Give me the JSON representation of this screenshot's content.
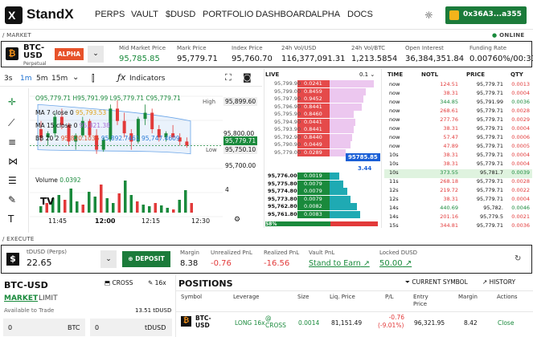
{
  "nav": {
    "brand": "StandX",
    "links": [
      "PERPS",
      "VAULT",
      "$DUSD",
      "PORTFOLIO",
      "DASHBOARD",
      "ALPHA",
      "DOCS"
    ],
    "wallet": "0x36A3...a355"
  },
  "sections": {
    "market": "/ MARKET",
    "online": "ONLINE",
    "execute": "/ EXECUTE"
  },
  "ticker": {
    "symbol": "BTC-USD",
    "subtitle": "Perpetual",
    "badge": "ALPHA",
    "stats": [
      {
        "label": "Mid Market Price",
        "value": "95,785.85",
        "color": "#1a8a3c"
      },
      {
        "label": "Mark Price",
        "value": "95,779.71"
      },
      {
        "label": "Index Price",
        "value": "95,760.70"
      },
      {
        "label": "24h Vol/USD",
        "value": "116,377,091.31"
      },
      {
        "label": "24h Vol/BTC",
        "value": "1,213.5854"
      },
      {
        "label": "Open Interest",
        "value": "36,384,351.84"
      },
      {
        "label": "Funding Rate",
        "value": "0.00760%/00:33"
      }
    ]
  },
  "chart": {
    "intervals": [
      "3s",
      "1m",
      "5m",
      "15m"
    ],
    "active_interval": "1m",
    "indicators_label": "Indicators",
    "ohlc": {
      "o": "O95,779.71",
      "h": "H95,791.99",
      "l": "L95,779.71",
      "c": "C95,779.71"
    },
    "ma7": {
      "label": "MA 7 close 0",
      "value": "95,793.53"
    },
    "ma15": {
      "label": "MA 15 close 0",
      "value": "95,821.38"
    },
    "bb": {
      "label": "BB 20 2",
      "v1": "95,820.1035",
      "v2": "95,892.7461",
      "v3": "95,747.4609"
    },
    "volume": {
      "label": "Volume",
      "value": "0.0392"
    },
    "high_label": "High",
    "high_value": "95,899.60",
    "low_label": "Low",
    "low_value": "95,750.10",
    "current_price": "95,779.71",
    "price_ticks": [
      "95,800.00",
      "95,700.00"
    ],
    "vol_tick": "4",
    "time_ticks": [
      "11:45",
      "12:00",
      "12:15",
      "12:30"
    ],
    "candles": [
      [
        95820,
        95840,
        95790,
        95800
      ],
      [
        95800,
        95815,
        95780,
        95810
      ],
      [
        95810,
        95860,
        95800,
        95850
      ],
      [
        95850,
        95870,
        95820,
        95830
      ],
      [
        95830,
        95835,
        95780,
        95790
      ],
      [
        95790,
        95810,
        95770,
        95805
      ],
      [
        95805,
        95850,
        95800,
        95840
      ],
      [
        95840,
        95845,
        95800,
        95805
      ],
      [
        95805,
        95820,
        95760,
        95770
      ],
      [
        95770,
        95800,
        95765,
        95795
      ],
      [
        95795,
        95880,
        95790,
        95870
      ],
      [
        95870,
        95890,
        95830,
        95840
      ],
      [
        95840,
        95860,
        95800,
        95810
      ],
      [
        95810,
        95820,
        95770,
        95790
      ],
      [
        95790,
        95850,
        95785,
        95845
      ],
      [
        95845,
        95880,
        95830,
        95860
      ],
      [
        95860,
        95870,
        95810,
        95820
      ],
      [
        95820,
        95830,
        95790,
        95800
      ],
      [
        95800,
        95815,
        95790,
        95810
      ],
      [
        95810,
        95830,
        95795,
        95800
      ],
      [
        95800,
        95810,
        95780,
        95790
      ],
      [
        95790,
        95800,
        95775,
        95780
      ]
    ]
  },
  "orderbook": {
    "title": "LIVE",
    "tick": "0.1",
    "asks": [
      [
        "95,799.90",
        "0.0241"
      ],
      [
        "95,799.00",
        "0.8459"
      ],
      [
        "95,797.90",
        "0.9452"
      ],
      [
        "95,796.90",
        "0.8441"
      ],
      [
        "95,795.90",
        "0.8460"
      ],
      [
        "95,794.90",
        "0.0441"
      ],
      [
        "95,793.90",
        "0.8441"
      ],
      [
        "95,792.90",
        "0.8440"
      ],
      [
        "95,790.90",
        "0.0449"
      ],
      [
        "95,779.00",
        "0.0289"
      ]
    ],
    "bids": [
      [
        "95,776.00",
        "0.0019"
      ],
      [
        "95,775.80",
        "0.0079"
      ],
      [
        "95,774.80",
        "0.0079"
      ],
      [
        "95,773.80",
        "0.0079"
      ],
      [
        "95,762.80",
        "0.0082"
      ],
      [
        "95,761.80",
        "0.0083"
      ]
    ],
    "mid_price": "95785.85",
    "spread": "3.44",
    "bid_pct": "58%",
    "ask_pct": "42%"
  },
  "trades": {
    "headers": [
      "TIME",
      "NOTL",
      "PRICE",
      "QTY"
    ],
    "rows": [
      [
        "now",
        "124.51",
        "95,779.71",
        "0.0013",
        "red"
      ],
      [
        "now",
        "38.31",
        "95,779.71",
        "0.0004",
        "red"
      ],
      [
        "now",
        "344.85",
        "95,791.99",
        "0.0036",
        "green"
      ],
      [
        "now",
        "268.61",
        "95,779.71",
        "0.0028",
        "red"
      ],
      [
        "now",
        "277.76",
        "95,779.71",
        "0.0029",
        "red"
      ],
      [
        "now",
        "38.31",
        "95,779.71",
        "0.0004",
        "red"
      ],
      [
        "now",
        "57.47",
        "95,779.71",
        "0.0006",
        "red"
      ],
      [
        "now",
        "47.89",
        "95,779.71",
        "0.0005",
        "red"
      ],
      [
        "10s",
        "38.31",
        "95,779.71",
        "0.0004",
        "red"
      ],
      [
        "10s",
        "38.31",
        "95,779.71",
        "0.0004",
        "red"
      ],
      [
        "10s",
        "373.55",
        "95,781.7",
        "0.0039",
        "green"
      ],
      [
        "11s",
        "268.18",
        "95,779.71",
        "0.0028",
        "red"
      ],
      [
        "12s",
        "219.72",
        "95,779.71",
        "0.0022",
        "red"
      ],
      [
        "12s",
        "38.31",
        "95,779.71",
        "0.0004",
        "red"
      ],
      [
        "14s",
        "440.69",
        "95,782.",
        "0.0046",
        "green"
      ],
      [
        "14s",
        "201.16",
        "95,779.5",
        "0.0021",
        "red"
      ],
      [
        "15s",
        "344.81",
        "95,779.71",
        "0.0036",
        "red"
      ]
    ]
  },
  "account": {
    "asset": "tDUSD (Perps)",
    "balance": "22.65",
    "deposit": "DEPOSIT",
    "margin_label": "Margin",
    "margin": "8.38",
    "upnl_label": "Unrealized PnL",
    "upnl": "-0.76",
    "rpnl_label": "Realized PnL",
    "rpnl": "-16.56",
    "vault_label": "Vault PnL",
    "vault": "Stand to Earn",
    "locked_label": "Locked DUSD",
    "locked": "50.00"
  },
  "order": {
    "symbol": "BTC-USD",
    "cross": "CROSS",
    "leverage": "16x",
    "tab_market": "MARKET",
    "tab_limit": "LIMIT",
    "avail_label": "Available to Trade",
    "avail": "13.51 tDUSD",
    "qty": "0",
    "qty_unit": "BTC",
    "amt": "0",
    "amt_unit": "tDUSD"
  },
  "positions": {
    "title": "POSITIONS",
    "current_symbol": "CURRENT SYMBOL",
    "history": "HISTORY",
    "headers": [
      "Symbol",
      "Leverage",
      "Size",
      "Liq. Price",
      "P/L",
      "Entry Price",
      "Margin",
      "Actions"
    ],
    "row": {
      "symbol": "BTC-USD",
      "leverage": "LONG 16x",
      "mode": "@ CROSS",
      "size": "0.0014",
      "liq": "81,151.49",
      "pl": "-0.76",
      "pl_pct": "(-9.01%)",
      "entry": "96,321.95",
      "margin": "8.42",
      "action": "Close"
    }
  }
}
